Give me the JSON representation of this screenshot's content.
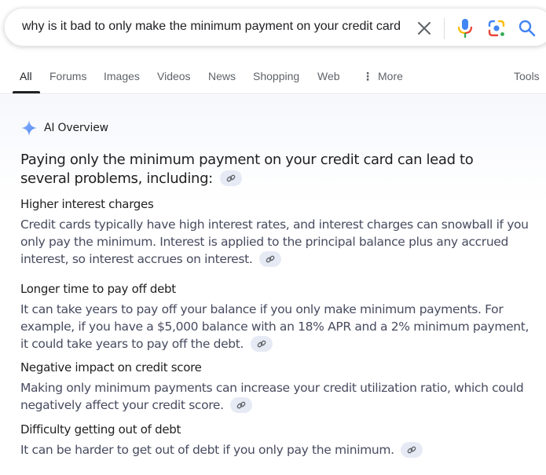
{
  "search": {
    "query": "why is it bad to only make the minimum payment on your credit card",
    "clear_icon": "close-icon",
    "voice_icon": "microphone-icon",
    "lens_icon": "camera-lens-icon",
    "search_icon": "search-icon"
  },
  "tabs": [
    {
      "label": "All",
      "active": true
    },
    {
      "label": "Forums"
    },
    {
      "label": "Images"
    },
    {
      "label": "Videos"
    },
    {
      "label": "News"
    },
    {
      "label": "Shopping"
    },
    {
      "label": "Web"
    },
    {
      "label": "More",
      "icon": "more-vert-icon"
    }
  ],
  "tools_label": "Tools",
  "ai_overview": {
    "title": "AI Overview",
    "intro": "Paying only the minimum payment on your credit card can lead to several problems, including:",
    "sections": [
      {
        "title": "Higher interest charges",
        "body": "Credit cards typically have high interest rates, and interest charges can snowball if you only pay the minimum. Interest is applied to the principal balance plus any accrued interest, so interest accrues on interest."
      },
      {
        "title": "Longer time to pay off debt",
        "body": "It can take years to pay off your balance if you only make minimum payments. For example, if you have a $5,000 balance with an 18% APR and a 2% minimum payment, it could take years to pay off the debt."
      },
      {
        "title": "Negative impact on credit score",
        "body": "Making only minimum payments can increase your credit utilization ratio, which could negatively affect your credit score."
      },
      {
        "title": "Difficulty getting out of debt",
        "body": "It can be harder to get out of debt if you only pay the minimum."
      }
    ]
  },
  "colors": {
    "accent_blue": "#4285f4",
    "text_primary": "#1f1f1f",
    "text_secondary": "#474b5f",
    "chip_bg": "#e6eaf4"
  }
}
